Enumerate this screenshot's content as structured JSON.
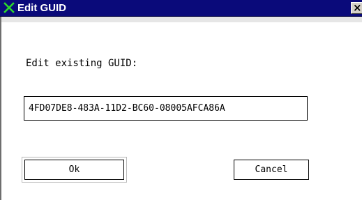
{
  "window": {
    "title": "Edit GUID",
    "close_glyph": "×",
    "title_icon": "x-mark-icon",
    "title_bar_color": "#0a0a7a"
  },
  "dialog": {
    "prompt": "Edit existing GUID:",
    "guid_value": "4FD07DE8-483A-11D2-BC60-08005AFCA86A",
    "ok_label": "Ok",
    "cancel_label": "Cancel"
  }
}
